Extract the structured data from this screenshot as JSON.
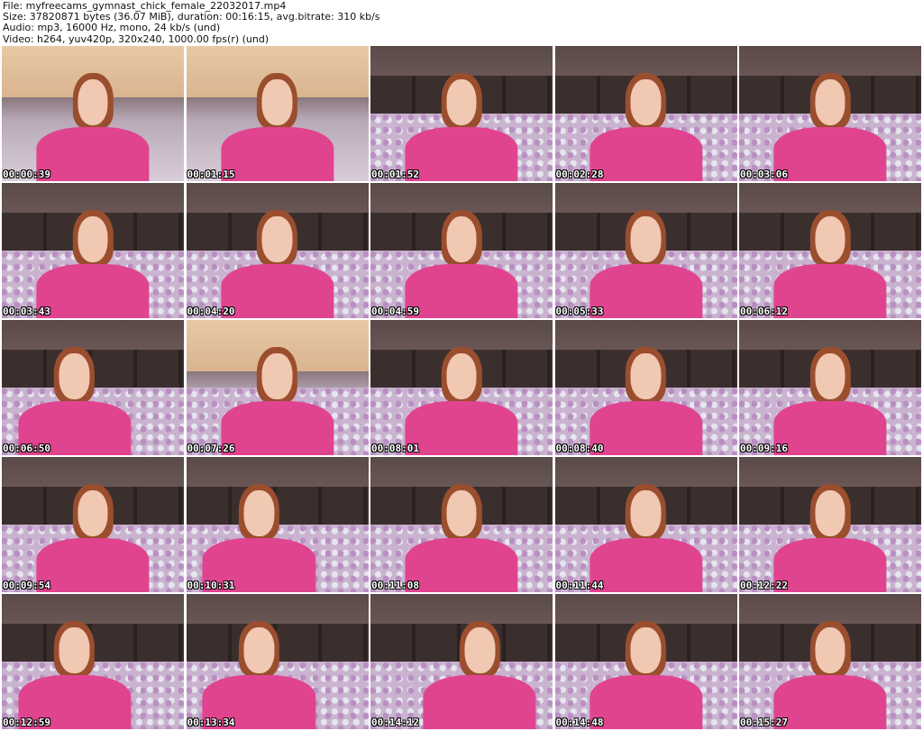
{
  "header": {
    "file_line": "File: myfreecams_gymnast_chick_female_22032017.mp4",
    "size_line": "Size: 37820871 bytes (36.07 MiB), duration: 00:16:15, avg.bitrate: 310 kb/s",
    "audio_line": "Audio: mp3, 16000 Hz, mono, 24 kb/s (und)",
    "video_line": "Video: h264, yuv420p, 320x240, 1000.00 fps(r) (und)"
  },
  "thumbnails": [
    {
      "time": "00:00:39"
    },
    {
      "time": "00:01:15"
    },
    {
      "time": "00:01:52"
    },
    {
      "time": "00:02:28"
    },
    {
      "time": "00:03:06"
    },
    {
      "time": "00:03:43"
    },
    {
      "time": "00:04:20"
    },
    {
      "time": "00:04:59"
    },
    {
      "time": "00:05:33"
    },
    {
      "time": "00:06:12"
    },
    {
      "time": "00:06:50"
    },
    {
      "time": "00:07:26"
    },
    {
      "time": "00:08:01"
    },
    {
      "time": "00:08:40"
    },
    {
      "time": "00:09:16"
    },
    {
      "time": "00:09:54"
    },
    {
      "time": "00:10:31"
    },
    {
      "time": "00:11:08"
    },
    {
      "time": "00:11:44"
    },
    {
      "time": "00:12:22"
    },
    {
      "time": "00:12:59"
    },
    {
      "time": "00:13:34"
    },
    {
      "time": "00:14:12"
    },
    {
      "time": "00:14:48"
    },
    {
      "time": "00:15:27"
    }
  ],
  "colors": {
    "background": "#ffffff",
    "timestamp_text": "#ffffff",
    "shirt": "#e0448f"
  }
}
